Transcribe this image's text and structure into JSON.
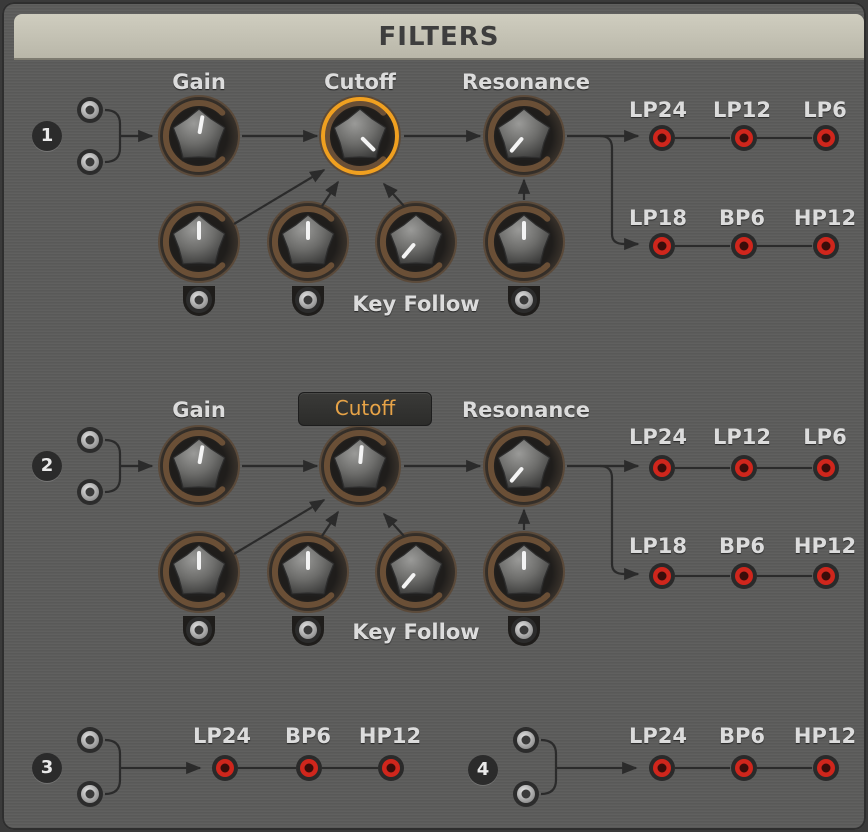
{
  "header": {
    "title": "FILTERS"
  },
  "filters": [
    {
      "number": "1",
      "gain_label": "Gain",
      "cutoff_label": "Cutoff",
      "resonance_label": "Resonance",
      "key_follow_label": "Key Follow",
      "cutoff_selected": true,
      "outputs_row1": [
        "LP24",
        "LP12",
        "LP6"
      ],
      "outputs_row2": [
        "LP18",
        "BP6",
        "HP12"
      ]
    },
    {
      "number": "2",
      "gain_label": "Gain",
      "cutoff_label": "Cutoff",
      "resonance_label": "Resonance",
      "key_follow_label": "Key Follow",
      "cutoff_display_box": true,
      "outputs_row1": [
        "LP24",
        "LP12",
        "LP6"
      ],
      "outputs_row2": [
        "LP18",
        "BP6",
        "HP12"
      ]
    },
    {
      "number": "3",
      "outputs": [
        "LP24",
        "BP6",
        "HP12"
      ]
    },
    {
      "number": "4",
      "outputs": [
        "LP24",
        "BP6",
        "HP12"
      ]
    }
  ],
  "colors": {
    "accent": "#f0a020",
    "cutoff_text": "#e7a347",
    "port_red": "#d0261c",
    "label": "#dcdcdc"
  },
  "icons": [
    "input-port-icon",
    "output-port-icon",
    "knob-icon"
  ]
}
